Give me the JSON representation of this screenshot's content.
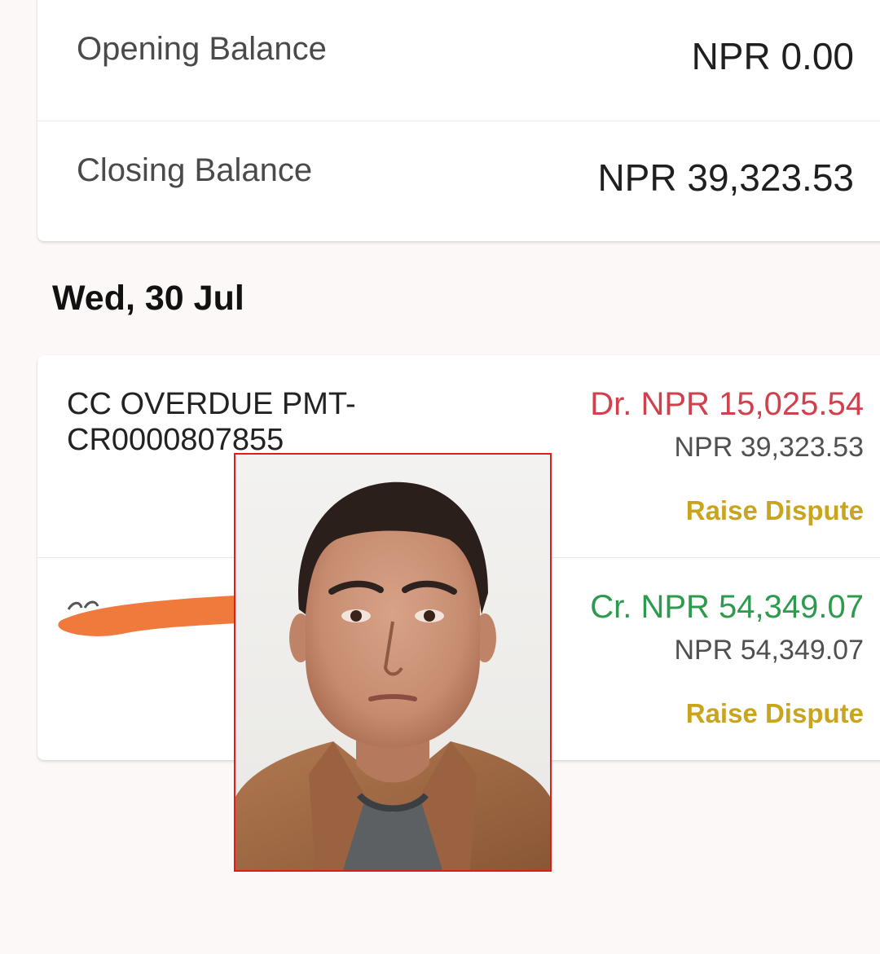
{
  "balances": {
    "opening_label": "Opening Balance",
    "opening_value": "NPR 0.00",
    "closing_label": "Closing Balance",
    "closing_value": "NPR 39,323.53"
  },
  "date_heading": "Wed, 30 Jul",
  "transactions": [
    {
      "description": "CC OVERDUE PMT-CR0000807855",
      "amount": "Dr. NPR 15,025.54",
      "type": "debit",
      "balance": "NPR 39,323.53",
      "action_label": "Raise Dispute"
    },
    {
      "description": "",
      "amount": "Cr. NPR 54,349.07",
      "type": "credit",
      "balance": "NPR 54,349.07",
      "action_label": "Raise Dispute"
    }
  ],
  "colors": {
    "debit": "#d0404d",
    "credit": "#2e9a4e",
    "dispute": "#c9a41c",
    "photo_border": "#e21a1a",
    "redaction": "#f07a3c"
  },
  "overlays": {
    "redaction_icon": "scribble-redaction",
    "photo_icon": "passport-photo"
  }
}
